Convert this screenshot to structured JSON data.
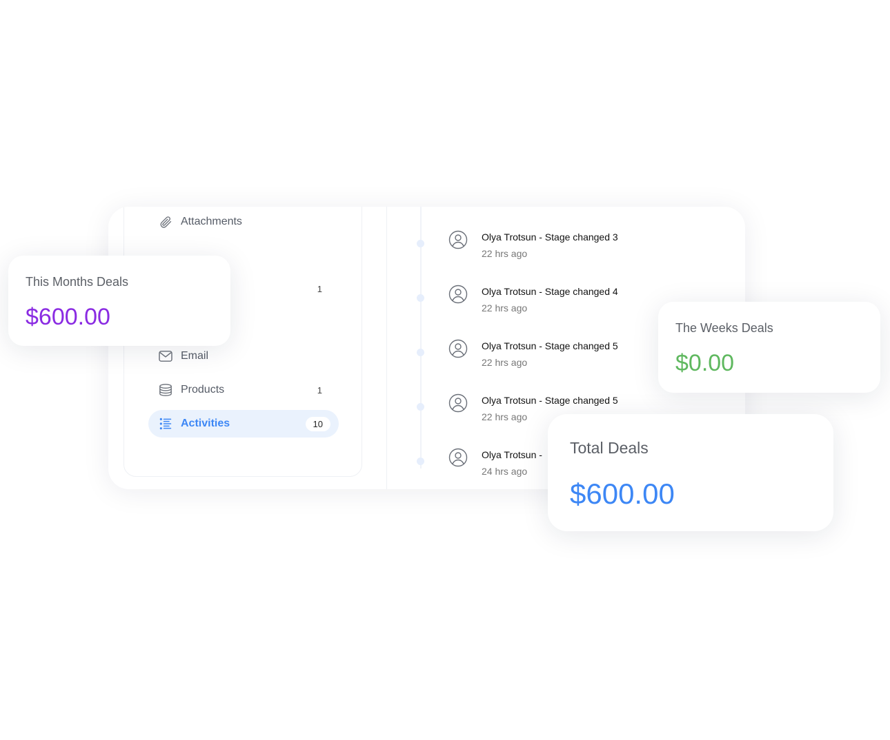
{
  "sidebar": {
    "items": [
      {
        "label": "Attachments",
        "count": "",
        "icon": "paperclip-icon"
      },
      {
        "label": "",
        "count": "1",
        "icon": ""
      },
      {
        "label": "Email",
        "count": "",
        "icon": "mail-icon"
      },
      {
        "label": "Products",
        "count": "1",
        "icon": "stack-icon"
      },
      {
        "label": "Activities",
        "count": "10",
        "icon": "list-icon"
      }
    ]
  },
  "timeline": [
    {
      "title": "Olya Trotsun - Stage changed 3",
      "time": "22 hrs ago"
    },
    {
      "title": "Olya Trotsun - Stage changed 4",
      "time": "22 hrs ago"
    },
    {
      "title": "Olya Trotsun - Stage changed 5",
      "time": "22 hrs ago"
    },
    {
      "title": "Olya Trotsun - Stage changed 5",
      "time": "22 hrs ago"
    },
    {
      "title": "Olya Trotsun -",
      "time": "24 hrs ago"
    }
  ],
  "stats": {
    "month": {
      "label": "This Months Deals",
      "value": "$600.00",
      "color": "#8a2be2"
    },
    "week": {
      "label": "The Weeks Deals",
      "value": "$0.00",
      "color": "#5fb85f"
    },
    "total": {
      "label": "Total Deals",
      "value": "$600.00",
      "color": "#3d87f5"
    }
  },
  "colors": {
    "accent": "#3d87f5",
    "active_bg": "#eaf2fd"
  }
}
